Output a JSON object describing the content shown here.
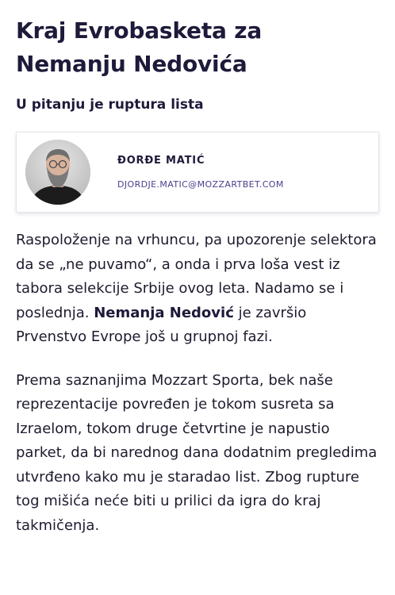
{
  "article": {
    "headline_line1": "Kraj Evrobasketa za",
    "headline_line2": "Nemanju Nedovića",
    "subtitle": "U pitanju je ruptura lista",
    "author": {
      "name": "ĐORĐE MATIĆ",
      "email": "DJORDJE.MATIC@MOZZARTBET.COM"
    },
    "paragraph1": {
      "before_link": "Raspoloženje na vrhuncu, pa upozorenje selektora da se „ne puvamo“, a onda i prva loša vest iz tabora selekcije Srbije ovog leta. Nadamo se i poslednja. ",
      "link": "Nemanja Nedović",
      "after_link": " je završio Prvenstvo Evrope još u grupnoj fazi."
    },
    "paragraph2": "Prema saznanjima Mozzart Sporta, bek naše reprezentacije povređen je tokom susreta sa Izraelom, tokom druge četvrtine je napustio parket, da bi narednog dana dodatnim pregledima utvrđeno kako mu je staradao list. Zbog rupture tog mišića neće biti u prilici da igra do kraj takmičenja."
  },
  "colors": {
    "heading": "#1d1a3a",
    "email": "#4a3f8c",
    "text": "#1e1b2e"
  },
  "icons": {
    "avatar": "author-photo"
  }
}
